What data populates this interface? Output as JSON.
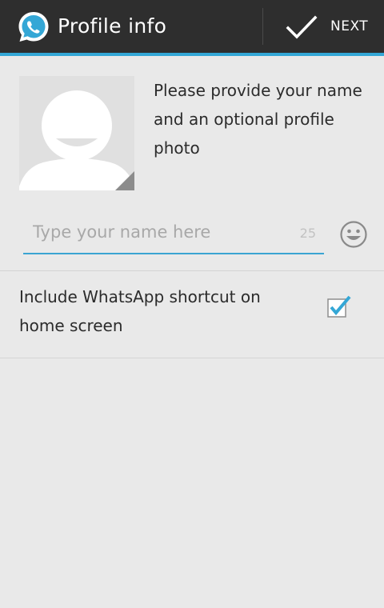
{
  "action_bar": {
    "title": "Profile info",
    "next_label": "NEXT",
    "logo_icon": "whatsapp-logo-icon",
    "confirm_icon": "check-icon"
  },
  "profile": {
    "prompt": "Please provide your name and an optional profile photo",
    "photo_icon": "default-avatar-icon"
  },
  "name_field": {
    "placeholder": "Type your name here",
    "value": "",
    "counter": "25",
    "emoji_icon": "smiley-icon"
  },
  "shortcut": {
    "label": "Include WhatsApp shortcut on home screen",
    "checked": true
  },
  "colors": {
    "action_bar": "#2e2e2e",
    "accent": "#34a7d6",
    "background": "#e9e9e9",
    "text": "#2b2b2b"
  }
}
